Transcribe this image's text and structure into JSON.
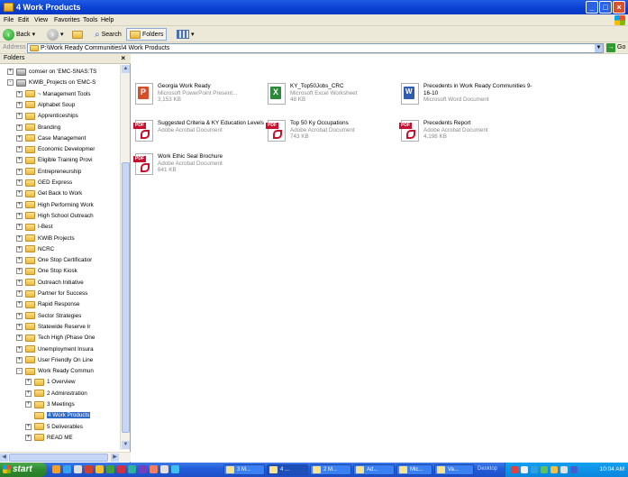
{
  "window": {
    "title": "4 Work Products"
  },
  "menu": [
    "File",
    "Edit",
    "View",
    "Favorites",
    "Tools",
    "Help"
  ],
  "toolbar": {
    "back": "Back",
    "search": "Search",
    "folders": "Folders"
  },
  "address": {
    "label": "Address",
    "path": "P:\\Work Ready Communities\\4 Work Products",
    "go": "Go"
  },
  "folders_pane": {
    "title": "Folders",
    "close": "×",
    "tree": [
      {
        "label": "comser on 'EMC-SNAS:TS",
        "depth": 0,
        "toggle": "+",
        "icon": "network"
      },
      {
        "label": "KWIB_Projects on 'EMC-S",
        "depth": 0,
        "toggle": "-",
        "icon": "network"
      },
      {
        "label": "~ Management Tools",
        "depth": 1,
        "toggle": "+",
        "icon": "folder"
      },
      {
        "label": "Alphabet Soup",
        "depth": 1,
        "toggle": "+",
        "icon": "folder"
      },
      {
        "label": "Apprenticeships",
        "depth": 1,
        "toggle": "+",
        "icon": "folder"
      },
      {
        "label": "Branding",
        "depth": 1,
        "toggle": "+",
        "icon": "folder"
      },
      {
        "label": "Case Management",
        "depth": 1,
        "toggle": "+",
        "icon": "folder"
      },
      {
        "label": "Economic Developmer",
        "depth": 1,
        "toggle": "+",
        "icon": "folder"
      },
      {
        "label": "Eligible Training Provi",
        "depth": 1,
        "toggle": "+",
        "icon": "folder"
      },
      {
        "label": "Entrepreneurship",
        "depth": 1,
        "toggle": "+",
        "icon": "folder"
      },
      {
        "label": "GED Express",
        "depth": 1,
        "toggle": "+",
        "icon": "folder"
      },
      {
        "label": "Get Back to Work",
        "depth": 1,
        "toggle": "+",
        "icon": "folder"
      },
      {
        "label": "High Performing Work",
        "depth": 1,
        "toggle": "+",
        "icon": "folder"
      },
      {
        "label": "High School Outreach",
        "depth": 1,
        "toggle": "+",
        "icon": "folder"
      },
      {
        "label": "I-Best",
        "depth": 1,
        "toggle": "+",
        "icon": "folder"
      },
      {
        "label": "KWIB Projects",
        "depth": 1,
        "toggle": "+",
        "icon": "folder"
      },
      {
        "label": "NCRC",
        "depth": 1,
        "toggle": "+",
        "icon": "folder"
      },
      {
        "label": "One Stop Certificatior",
        "depth": 1,
        "toggle": "+",
        "icon": "folder"
      },
      {
        "label": "One Stop Kiosk",
        "depth": 1,
        "toggle": "+",
        "icon": "folder"
      },
      {
        "label": "Outreach Initiative",
        "depth": 1,
        "toggle": "+",
        "icon": "folder"
      },
      {
        "label": "Partner for Success",
        "depth": 1,
        "toggle": "+",
        "icon": "folder"
      },
      {
        "label": "Rapid Response",
        "depth": 1,
        "toggle": "+",
        "icon": "folder"
      },
      {
        "label": "Sector Strategies",
        "depth": 1,
        "toggle": "+",
        "icon": "folder"
      },
      {
        "label": "Statewide Reserve Ir",
        "depth": 1,
        "toggle": "+",
        "icon": "folder"
      },
      {
        "label": "Tech High (Phase One",
        "depth": 1,
        "toggle": "+",
        "icon": "folder"
      },
      {
        "label": "Unemployment Insura",
        "depth": 1,
        "toggle": "+",
        "icon": "folder"
      },
      {
        "label": "User Friendly On Line",
        "depth": 1,
        "toggle": "+",
        "icon": "folder"
      },
      {
        "label": "Work Ready Commun",
        "depth": 1,
        "toggle": "-",
        "icon": "folder"
      },
      {
        "label": "1 Overview",
        "depth": 2,
        "toggle": "+",
        "icon": "folder"
      },
      {
        "label": "2 Administration",
        "depth": 2,
        "toggle": "+",
        "icon": "folder"
      },
      {
        "label": "3 Meetings",
        "depth": 2,
        "toggle": "+",
        "icon": "folder"
      },
      {
        "label": "4 Work Products",
        "depth": 2,
        "toggle": "",
        "icon": "folder",
        "selected": true
      },
      {
        "label": "5 Deliverables",
        "depth": 2,
        "toggle": "+",
        "icon": "folder"
      },
      {
        "label": "READ ME",
        "depth": 2,
        "toggle": "+",
        "icon": "folder"
      }
    ]
  },
  "files": [
    {
      "name": "Georgia Work Ready",
      "type": "Microsoft PowerPoint Present...",
      "size": "3,153 KB",
      "icon": "ppt"
    },
    {
      "name": "KY_Top50Jobs_CRC",
      "type": "Microsoft Excel Worksheet",
      "size": "48 KB",
      "icon": "xls"
    },
    {
      "name": "Precedents in Work Ready Communities 9-16-10",
      "type": "Microsoft Word Document",
      "size": "",
      "icon": "doc"
    },
    {
      "name": "Suggested Criteria & KY Education Levels",
      "type": "Adobe Acrobat Document",
      "size": "",
      "icon": "pdf"
    },
    {
      "name": "Top 50 Ky Occupations",
      "type": "Adobe Acrobat Document",
      "size": "743 KB",
      "icon": "pdf"
    },
    {
      "name": "Precedents Report",
      "type": "Adobe Acrobat Document",
      "size": "4,198 KB",
      "icon": "pdf"
    },
    {
      "name": "Work Ethic Seal Brochure",
      "type": "Adobe Acrobat Document",
      "size": "641 KB",
      "icon": "pdf"
    }
  ],
  "taskbar": {
    "start": "start",
    "tasks": [
      {
        "label": "3 M...",
        "active": false
      },
      {
        "label": "4 ...",
        "active": true
      },
      {
        "label": "2 M...",
        "active": false
      },
      {
        "label": "Ad...",
        "active": false
      },
      {
        "label": "Mic...",
        "active": false
      },
      {
        "label": "Va...",
        "active": false
      }
    ],
    "desktop": "Desktop",
    "clock": "10:04 AM"
  }
}
